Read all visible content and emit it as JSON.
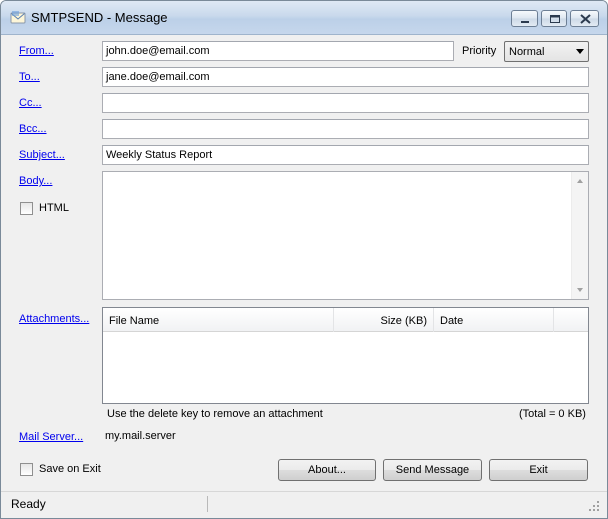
{
  "window": {
    "title": "SMTPSEND - Message"
  },
  "links": {
    "from": "From...",
    "to": "To...",
    "cc": "Cc...",
    "bcc": "Bcc...",
    "subject": "Subject...",
    "body": "Body...",
    "attachments": "Attachments...",
    "mail_server": "Mail Server..."
  },
  "fields": {
    "from": "john.doe@email.com",
    "to": "jane.doe@email.com",
    "cc": "",
    "bcc": "",
    "subject": "Weekly Status Report",
    "body": "",
    "mail_server": "my.mail.server"
  },
  "priority": {
    "label": "Priority",
    "selected": "Normal"
  },
  "html_checkbox": {
    "label": "HTML",
    "checked": false
  },
  "attachments_table": {
    "columns": [
      "File Name",
      "Size (KB)",
      "Date"
    ],
    "rows": [],
    "hint": "Use the delete key to remove an attachment",
    "total": "(Total = 0 KB)"
  },
  "save_on_exit": {
    "label": "Save on Exit",
    "checked": false
  },
  "buttons": {
    "about": "About...",
    "send": "Send Message",
    "exit": "Exit"
  },
  "status": {
    "text": "Ready"
  }
}
